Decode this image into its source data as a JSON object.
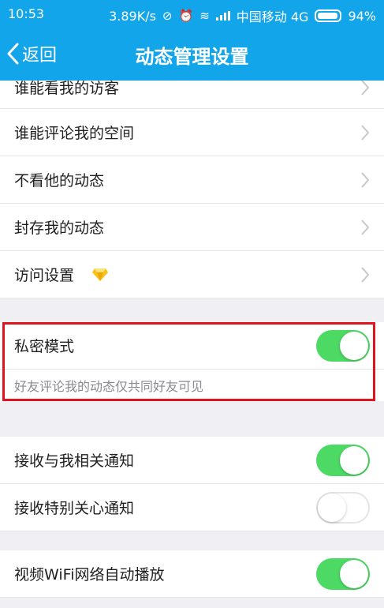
{
  "status": {
    "time": "10:53",
    "speed": "3.89K/s",
    "carrier": "中国移动 4G",
    "battery": "94%"
  },
  "nav": {
    "back_label": "返回",
    "title": "动态管理设置"
  },
  "rows": {
    "visitors": "谁能看我的访客",
    "comment": "谁能评论我的空间",
    "hide_feed": "不看他的动态",
    "archive": "封存我的动态",
    "access": "访问设置"
  },
  "privacy": {
    "label": "私密模式",
    "description": "好友评论我的动态仅共同好友可见",
    "enabled": true
  },
  "notifications": {
    "related_label": "接收与我相关通知",
    "related_enabled": true,
    "special_label": "接收特别关心通知",
    "special_enabled": false
  },
  "video": {
    "autoplay_label": "视频WiFi网络自动播放",
    "autoplay_enabled": true
  },
  "colors": {
    "accent": "#12a5ea",
    "toggle_on": "#4cd964",
    "highlight": "#e0141e"
  }
}
